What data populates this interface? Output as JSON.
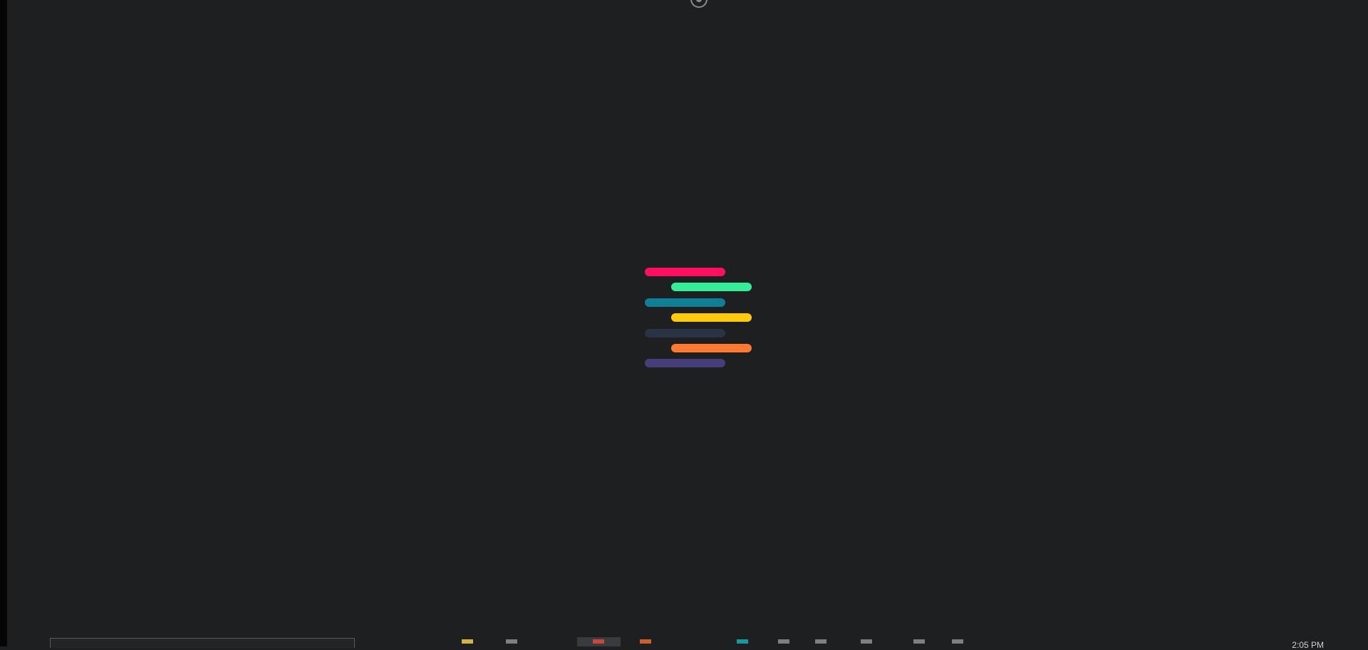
{
  "top_control": {
    "icon": "radio-target-icon"
  },
  "loader": {
    "bars": [
      {
        "color": "#ff0f5f"
      },
      {
        "color": "#33ee99"
      },
      {
        "color": "#0e7f94"
      },
      {
        "color": "#ffc90e"
      },
      {
        "color": "#2a3346"
      },
      {
        "color": "#ff7a2f"
      },
      {
        "color": "#463e78"
      }
    ]
  },
  "taskbar": {
    "caption": "",
    "apps": [
      {
        "name": "file-explorer-icon",
        "color": "#e8c24a"
      },
      {
        "name": "app-icon",
        "color": "#8a8a8a"
      },
      {
        "name": "active-app-icon",
        "color": "#d84a3a"
      },
      {
        "name": "app-icon",
        "color": "#e0682a"
      },
      {
        "name": "app-icon",
        "color": "#18a7b0"
      },
      {
        "name": "app-icon",
        "color": "#8a8a8a"
      },
      {
        "name": "app-icon",
        "color": "#8a8a8a"
      },
      {
        "name": "app-icon",
        "color": "#8a8a8a"
      },
      {
        "name": "app-icon",
        "color": "#8a8a8a"
      },
      {
        "name": "app-icon",
        "color": "#8a8a8a"
      }
    ],
    "clock": "2:05 PM"
  }
}
